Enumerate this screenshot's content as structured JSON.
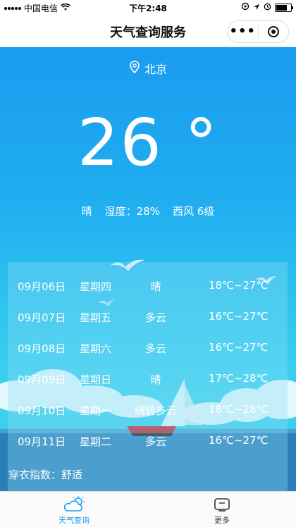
{
  "status_bar": {
    "carrier": "中国电信",
    "time": "下午2:48"
  },
  "nav": {
    "title": "天气查询服务",
    "more_label": "•••"
  },
  "weather": {
    "city": "北京",
    "temperature": "26 °",
    "condition": "晴",
    "humidity": "湿度：28%",
    "wind": "西风 6级"
  },
  "forecast": [
    {
      "date": "09月06日",
      "weekday": "星期四",
      "condition": "晴",
      "temp": "18℃~27℃"
    },
    {
      "date": "09月07日",
      "weekday": "星期五",
      "condition": "多云",
      "temp": "16℃~27℃"
    },
    {
      "date": "09月08日",
      "weekday": "星期六",
      "condition": "多云",
      "temp": "16℃~27℃"
    },
    {
      "date": "09月09日",
      "weekday": "星期日",
      "condition": "晴",
      "temp": "17℃~28℃"
    },
    {
      "date": "09月10日",
      "weekday": "星期一",
      "condition": "晴转多云",
      "temp": "18℃~28℃"
    },
    {
      "date": "09月11日",
      "weekday": "星期二",
      "condition": "多云",
      "temp": "16℃~27℃"
    }
  ],
  "dress_index": "穿衣指数：舒适",
  "tabs": [
    {
      "label": "天气查询",
      "icon": "cloud-sun-icon",
      "active": true
    },
    {
      "label": "更多",
      "icon": "tv-icon",
      "active": false
    }
  ],
  "colors": {
    "accent": "#1a9cf0",
    "sky_top": "#1a9cf0",
    "sky_bottom": "#3fd3ee"
  }
}
